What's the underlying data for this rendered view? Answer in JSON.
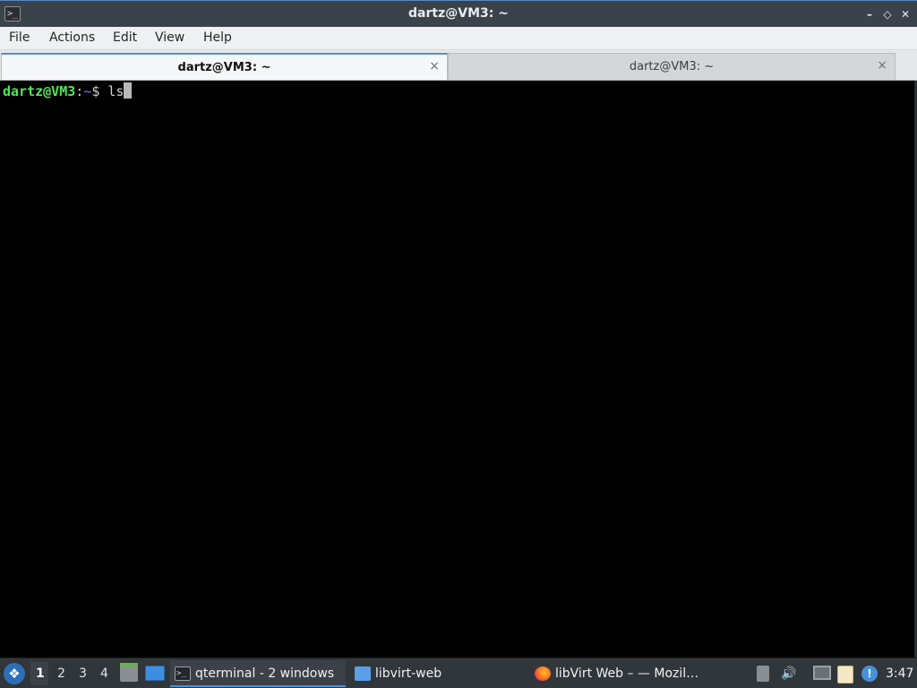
{
  "window": {
    "title": "dartz@VM3: ~",
    "app_icon": ">_",
    "minimize_glyph": "–",
    "restore_glyph": "◇",
    "close_glyph": "✕"
  },
  "menu": {
    "items": [
      "File",
      "Actions",
      "Edit",
      "View",
      "Help"
    ]
  },
  "tabs": [
    {
      "label": "dartz@VM3: ~",
      "active": true,
      "close": "×"
    },
    {
      "label": "dartz@VM3: ~",
      "active": false,
      "close": "×"
    }
  ],
  "terminal": {
    "prompt_user": "dartz@VM3",
    "prompt_sep": ":",
    "prompt_path": "~",
    "prompt_dollar": "$ ",
    "command": "ls"
  },
  "taskbar": {
    "start_icon": "start-menu-icon",
    "workspaces": [
      "1",
      "2",
      "3",
      "4"
    ],
    "active_workspace": "1",
    "tasks": [
      {
        "label": "qterminal - 2 windows",
        "icon": "terminal-icon",
        "active": true
      },
      {
        "label": "libvirt-web",
        "icon": "folder-icon",
        "active": false
      },
      {
        "label": "libVirt Web – — Mozil…",
        "icon": "firefox-icon",
        "active": false
      }
    ],
    "volume_glyph": "🔊",
    "notify_glyph": "!",
    "clock": "3:47"
  },
  "colors": {
    "accent": "#4a90d9",
    "prompt_user": "#54e35a",
    "prompt_path": "#6f7bff",
    "taskbar_bg": "#31363b",
    "titlebar_bg": "#3a424a"
  }
}
